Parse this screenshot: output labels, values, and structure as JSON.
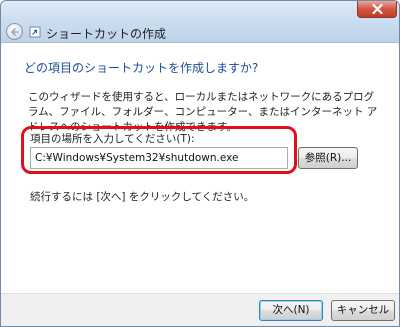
{
  "window": {
    "title": "ショートカットの作成"
  },
  "main": {
    "heading": "どの項目のショートカットを作成しますか?",
    "description": "このウィザードを使用すると、ローカルまたはネットワークにあるプログラム、ファイル、フォルダー、コンピューター、またはインターネット アドレスへのショートカットを作成できます。",
    "location_label": "項目の場所を入力してください(T):",
    "location_value": "C:¥Windows¥System32¥shutdown.exe",
    "browse_label": "参照(R)...",
    "instruction": "続行するには [次へ] をクリックしてください。"
  },
  "footer": {
    "next_label": "次へ(N)",
    "cancel_label": "キャンセル"
  },
  "colors": {
    "heading": "#1f4da0",
    "highlight": "#e0101a",
    "close": "#c23a22"
  },
  "icons": [
    "close-icon",
    "back-arrow-icon",
    "shortcut-icon"
  ]
}
